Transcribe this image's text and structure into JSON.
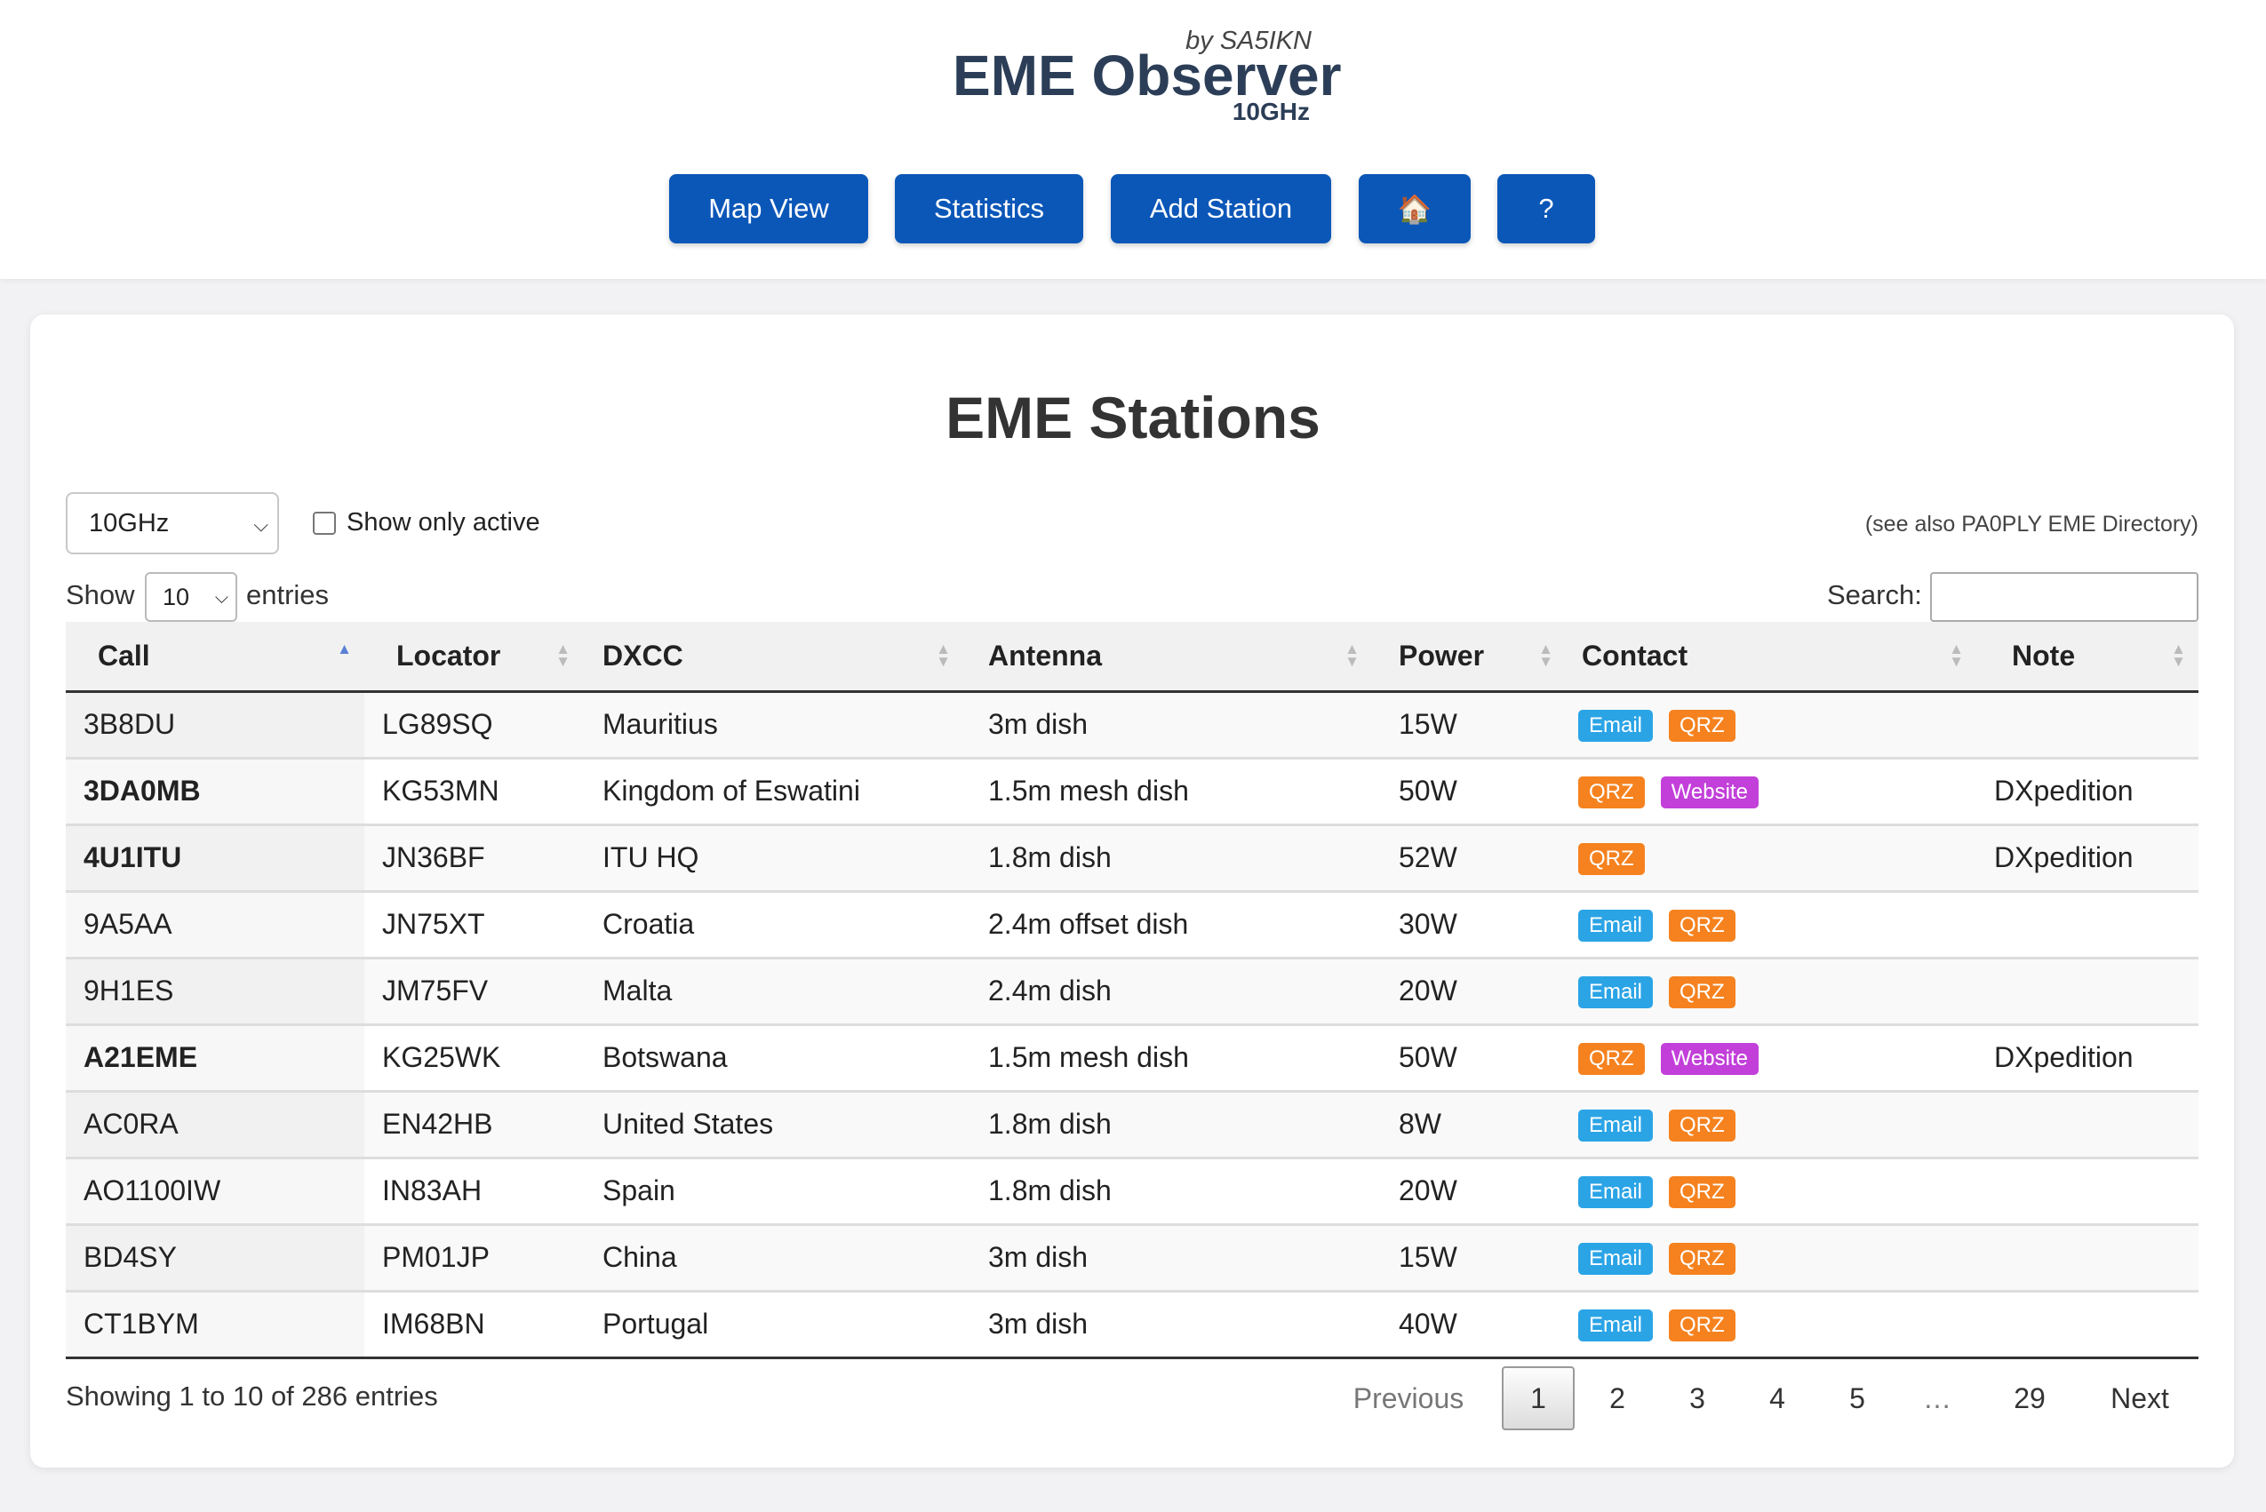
{
  "header": {
    "byline": "by SA5IKN",
    "title": "EME Observer",
    "band": "10GHz",
    "nav": {
      "map": "Map View",
      "stats": "Statistics",
      "add": "Add Station",
      "home": "🏠",
      "help": "?"
    }
  },
  "main": {
    "title": "EME Stations",
    "band_select": "10GHz",
    "show_active_label": "Show only active",
    "see_also": "(see also PA0PLY EME Directory)",
    "show_label": "Show",
    "page_length": "10",
    "entries_label": "entries",
    "search_label": "Search:",
    "columns": [
      "Call",
      "Locator",
      "DXCC",
      "Antenna",
      "Power",
      "Contact",
      "Note"
    ],
    "rows": [
      {
        "call": "3B8DU",
        "bold": false,
        "locator": "LG89SQ",
        "dxcc": "Mauritius",
        "antenna": "3m dish",
        "power": "15W",
        "contacts": [
          "Email",
          "QRZ"
        ],
        "note": ""
      },
      {
        "call": "3DA0MB",
        "bold": true,
        "locator": "KG53MN",
        "dxcc": "Kingdom of Eswatini",
        "antenna": "1.5m mesh dish",
        "power": "50W",
        "contacts": [
          "QRZ",
          "Website"
        ],
        "note": "DXpedition"
      },
      {
        "call": "4U1ITU",
        "bold": true,
        "locator": "JN36BF",
        "dxcc": "ITU HQ",
        "antenna": "1.8m dish",
        "power": "52W",
        "contacts": [
          "QRZ"
        ],
        "note": "DXpedition"
      },
      {
        "call": "9A5AA",
        "bold": false,
        "locator": "JN75XT",
        "dxcc": "Croatia",
        "antenna": "2.4m offset dish",
        "power": "30W",
        "contacts": [
          "Email",
          "QRZ"
        ],
        "note": ""
      },
      {
        "call": "9H1ES",
        "bold": false,
        "locator": "JM75FV",
        "dxcc": "Malta",
        "antenna": "2.4m dish",
        "power": "20W",
        "contacts": [
          "Email",
          "QRZ"
        ],
        "note": ""
      },
      {
        "call": "A21EME",
        "bold": true,
        "locator": "KG25WK",
        "dxcc": "Botswana",
        "antenna": "1.5m mesh dish",
        "power": "50W",
        "contacts": [
          "QRZ",
          "Website"
        ],
        "note": "DXpedition"
      },
      {
        "call": "AC0RA",
        "bold": false,
        "locator": "EN42HB",
        "dxcc": "United States",
        "antenna": "1.8m dish",
        "power": "8W",
        "contacts": [
          "Email",
          "QRZ"
        ],
        "note": ""
      },
      {
        "call": "AO1100IW",
        "bold": false,
        "locator": "IN83AH",
        "dxcc": "Spain",
        "antenna": "1.8m dish",
        "power": "20W",
        "contacts": [
          "Email",
          "QRZ"
        ],
        "note": ""
      },
      {
        "call": "BD4SY",
        "bold": false,
        "locator": "PM01JP",
        "dxcc": "China",
        "antenna": "3m dish",
        "power": "15W",
        "contacts": [
          "Email",
          "QRZ"
        ],
        "note": ""
      },
      {
        "call": "CT1BYM",
        "bold": false,
        "locator": "IM68BN",
        "dxcc": "Portugal",
        "antenna": "3m dish",
        "power": "40W",
        "contacts": [
          "Email",
          "QRZ"
        ],
        "note": ""
      }
    ],
    "info": "Showing 1 to 10 of 286 entries",
    "pagination": {
      "previous": "Previous",
      "pages": [
        "1",
        "2",
        "3",
        "4",
        "5",
        "…",
        "29"
      ],
      "next": "Next",
      "current": "1"
    }
  },
  "colors": {
    "nav_button": "#0b57b8",
    "email_tag": "#2ba4e6",
    "qrz_tag": "#f5821f",
    "website_tag": "#c23fd9",
    "title": "#2c3e57"
  }
}
